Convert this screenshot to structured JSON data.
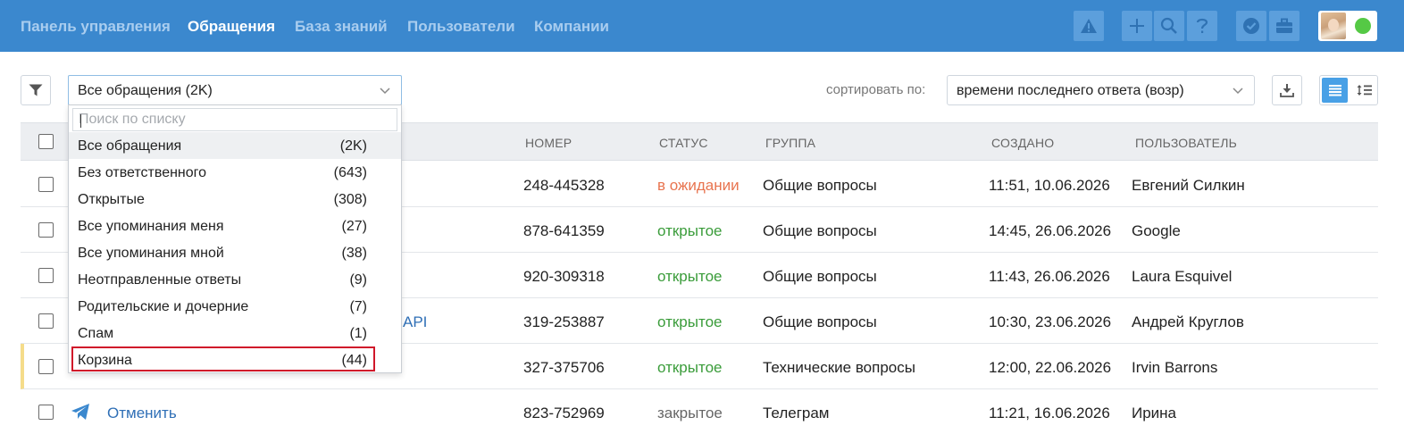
{
  "nav": {
    "items": [
      {
        "label": "Панель управления",
        "active": false
      },
      {
        "label": "Обращения",
        "active": true
      },
      {
        "label": "База знаний",
        "active": false
      },
      {
        "label": "Пользователи",
        "active": false
      },
      {
        "label": "Компании",
        "active": false
      }
    ],
    "buttons": [
      "warning-icon",
      "plus-icon",
      "search-icon",
      "help-icon",
      "check-badge-icon",
      "briefcase-icon"
    ],
    "status_color": "#55c945"
  },
  "toolbar": {
    "filter_view": "Все обращения (2K)",
    "sort_label": "сортировать по:",
    "sort_value": "времени последнего ответа (возр)"
  },
  "dropdown": {
    "search_placeholder": "Поиск по списку",
    "items": [
      {
        "label": "Все обращения",
        "count": "(2K)"
      },
      {
        "label": "Без ответственного",
        "count": "(643)"
      },
      {
        "label": "Открытые",
        "count": "(308)"
      },
      {
        "label": "Все упоминания меня",
        "count": "(27)"
      },
      {
        "label": "Все упоминания мной",
        "count": "(38)"
      },
      {
        "label": "Неотправленные ответы",
        "count": "(9)"
      },
      {
        "label": "Родительские и дочерние",
        "count": "(7)"
      },
      {
        "label": "Спам",
        "count": "(1)"
      },
      {
        "label": "Корзина",
        "count": "(44)"
      }
    ]
  },
  "table": {
    "headers": {
      "number": "НОМЕР",
      "status": "СТАТУС",
      "group": "ГРУППА",
      "created": "СОЗДАНО",
      "user": "ПОЛЬЗОВАТЕЛЬ"
    },
    "rows": [
      {
        "subject": "",
        "number": "248-445328",
        "status": "в ожидании",
        "group": "Общие вопросы",
        "created": "11:51, 10.06.2026",
        "user": "Евгений Силкин"
      },
      {
        "subject": "",
        "number": "878-641359",
        "status": "открытое",
        "group": "Общие вопросы",
        "created": "14:45, 26.06.2026",
        "user": "Google"
      },
      {
        "subject": "",
        "number": "920-309318",
        "status": "открытое",
        "group": "Общие вопросы",
        "created": "11:43, 26.06.2026",
        "user": "Laura Esquivel"
      },
      {
        "subject": "API",
        "number": "319-253887",
        "status": "открытое",
        "group": "Общие вопросы",
        "created": "10:30, 23.06.2026",
        "user": "Андрей Круглов"
      },
      {
        "subject": "",
        "number": "327-375706",
        "status": "открытое",
        "group": "Технические вопросы",
        "created": "12:00, 22.06.2026",
        "user": "Irvin Barrons"
      },
      {
        "subject": "Отменить",
        "number": "823-752969",
        "status": "закрытое",
        "group": "Телеграм",
        "created": "11:21, 16.06.2026",
        "user": "Ирина"
      }
    ]
  },
  "colors": {
    "topbar": "#3b88ce",
    "status_waiting": "#e8744f",
    "status_open": "#3a9c3a",
    "status_closed": "#666666",
    "highlight": "#d0172a"
  }
}
